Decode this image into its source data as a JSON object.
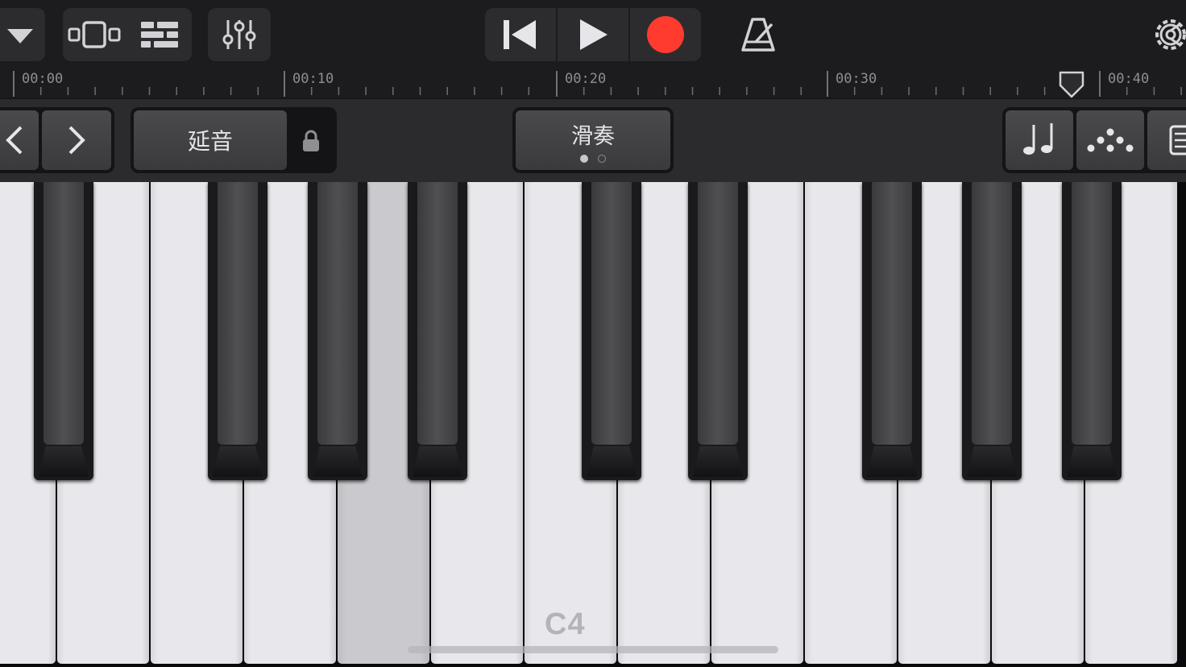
{
  "toolbar": {
    "items": [
      {
        "name": "track-menu-button",
        "icon": "triangle-down-icon"
      },
      {
        "name": "track-view-button",
        "icon": "tracks-view-icon"
      },
      {
        "name": "browser-button",
        "icon": "list-view-icon"
      },
      {
        "name": "mixer-button",
        "icon": "sliders-icon"
      },
      {
        "name": "go-to-start-button",
        "icon": "skip-back-icon"
      },
      {
        "name": "play-button",
        "icon": "play-icon"
      },
      {
        "name": "record-button",
        "icon": "record-icon"
      },
      {
        "name": "metronome-button",
        "icon": "metronome-icon"
      },
      {
        "name": "settings-button",
        "icon": "gear-icon"
      }
    ],
    "record_color": "#ff3b30"
  },
  "ruler": {
    "labels": [
      "00:00",
      "00:10",
      "00:20",
      "00:30",
      "00:40"
    ],
    "playhead_icon": "playhead-marker-icon"
  },
  "controls": {
    "octave_down_icon": "chevron-left-icon",
    "octave_up_icon": "chevron-right-icon",
    "sustain_label": "延音",
    "lock_icon": "lock-icon",
    "glissando_label": "滑奏",
    "page_dots": {
      "count": 2,
      "active": 0
    },
    "note_button_icon": "notes-icon",
    "arpeggiator_icon": "arpeggio-dots-icon",
    "keyboard_layout_icon": "keyboard-icon"
  },
  "keyboard": {
    "visible_white_keys": 13,
    "pressed_white_key_index": 4,
    "octave_label": "C4"
  }
}
